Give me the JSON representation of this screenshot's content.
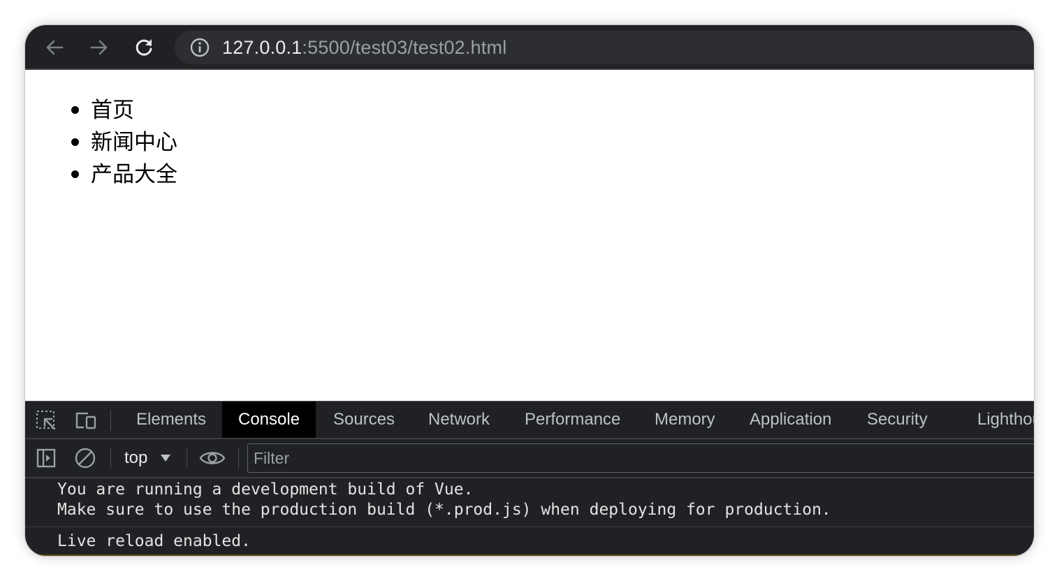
{
  "browser": {
    "url_host": "127.0.0.1",
    "url_path": ":5500/test03/test02.html",
    "icons": {
      "back": "arrow-left-icon",
      "forward": "arrow-right-icon",
      "reload": "reload-icon",
      "site_info": "info-icon"
    }
  },
  "page": {
    "list_items": [
      "首页",
      "新闻中心",
      "产品大全"
    ]
  },
  "devtools": {
    "tabs": [
      "Elements",
      "Console",
      "Sources",
      "Network",
      "Performance",
      "Memory",
      "Application",
      "Security",
      "Lighthouse"
    ],
    "active_tab": "Console",
    "context": "top",
    "filter_placeholder": "Filter",
    "messages": [
      "You are running a development build of Vue.\nMake sure to use the production build (*.prod.js) when deploying for production.",
      "Live reload enabled."
    ],
    "colors": {
      "panel_bg": "#202124",
      "active_tab_bg": "#000000",
      "text": "#e3e3e3"
    }
  }
}
